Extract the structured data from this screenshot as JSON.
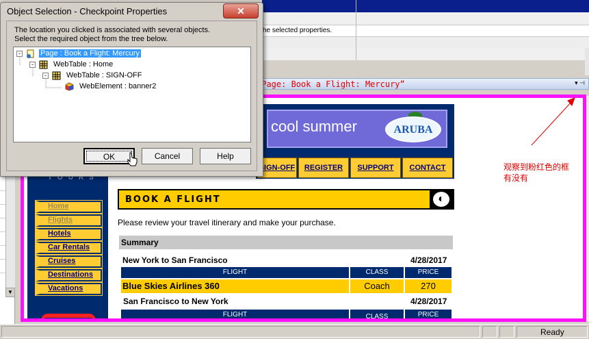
{
  "background_app": {
    "selected_properties_text": "he selected properties."
  },
  "dialog": {
    "title": "Object Selection - Checkpoint Properties",
    "close_label": "✕",
    "description_line1": "The location you clicked is associated with several objects.",
    "description_line2": "Select the required object from the tree below.",
    "tree": [
      {
        "label": "Page : Book a Flight: Mercury",
        "icon": "page-icon",
        "selected": true
      },
      {
        "label": "WebTable : Home",
        "icon": "webtable-icon",
        "selected": false
      },
      {
        "label": "WebTable : SIGN-OFF",
        "icon": "webtable-icon",
        "selected": false
      },
      {
        "label": "WebElement : banner2",
        "icon": "webelement-icon",
        "selected": false
      }
    ],
    "buttons": {
      "ok": "OK",
      "cancel": "Cancel",
      "help": "Help"
    }
  },
  "annotations": {
    "select_topmost": "选择最上面的“Page: Book a Flight: Mercury”",
    "observe_line1": "观察到粉红色的框",
    "observe_line2": "有没有"
  },
  "pane": {
    "pin_buttons": "▾ ⊣"
  },
  "web_page": {
    "tours_text": "TOURS",
    "banner_text": "cool summer",
    "banner_logo": "ARUBA",
    "top_nav": [
      "SIGN-OFF",
      "REGISTER",
      "SUPPORT",
      "CONTACT"
    ],
    "side_nav": [
      {
        "label": "Home",
        "active": false
      },
      {
        "label": "Flights",
        "active": false
      },
      {
        "label": "Hotels",
        "active": true
      },
      {
        "label": "Car Rentals",
        "active": true
      },
      {
        "label": "Cruises",
        "active": true
      },
      {
        "label": "Destinations",
        "active": true
      },
      {
        "label": "Vacations",
        "active": true
      }
    ],
    "book_title": "BOOK A FLIGHT",
    "review_text": "Please review your travel itinerary and make your purchase.",
    "summary_label": "Summary",
    "legs": [
      {
        "route": "New York to San Francisco",
        "date": "4/28/2017",
        "headers": [
          "FLIGHT",
          "CLASS",
          "PRICE"
        ],
        "airline": "Blue Skies Airlines 360",
        "class": "Coach",
        "price": "270"
      },
      {
        "route": "San Francisco to New York",
        "date": "4/28/2017",
        "headers": [
          "FLIGHT",
          "CLASS",
          "PRICE"
        ]
      }
    ]
  },
  "status_bar": {
    "status": "Ready"
  },
  "colors": {
    "pink_frame": "#ff10ff",
    "annotation": "#e00000",
    "navy": "#002a6e",
    "gold": "#ffcc00"
  }
}
